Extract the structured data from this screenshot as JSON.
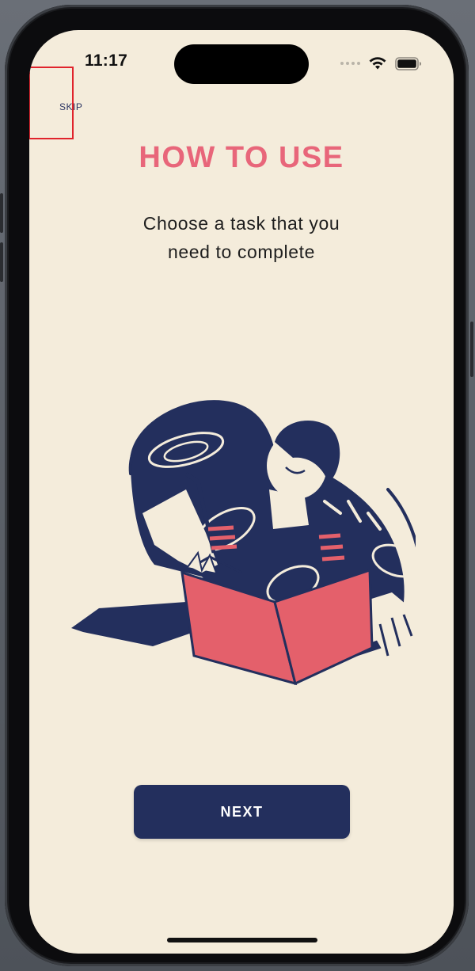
{
  "status_bar": {
    "time": "11:17",
    "icons": [
      "cellular-signal-icon",
      "wifi-icon",
      "battery-icon"
    ]
  },
  "onboarding": {
    "skip_label": "SKIP",
    "title": "HOW TO USE",
    "subtitle": "Choose a task that you need to complete",
    "next_label": "NEXT"
  },
  "colors": {
    "background": "#f4ecdb",
    "title": "#e8667a",
    "primary_navy": "#232f5d",
    "box_red": "#e4606b",
    "highlight_red": "#e0242c"
  },
  "illustration": {
    "icon": "person-in-box-illustration"
  }
}
